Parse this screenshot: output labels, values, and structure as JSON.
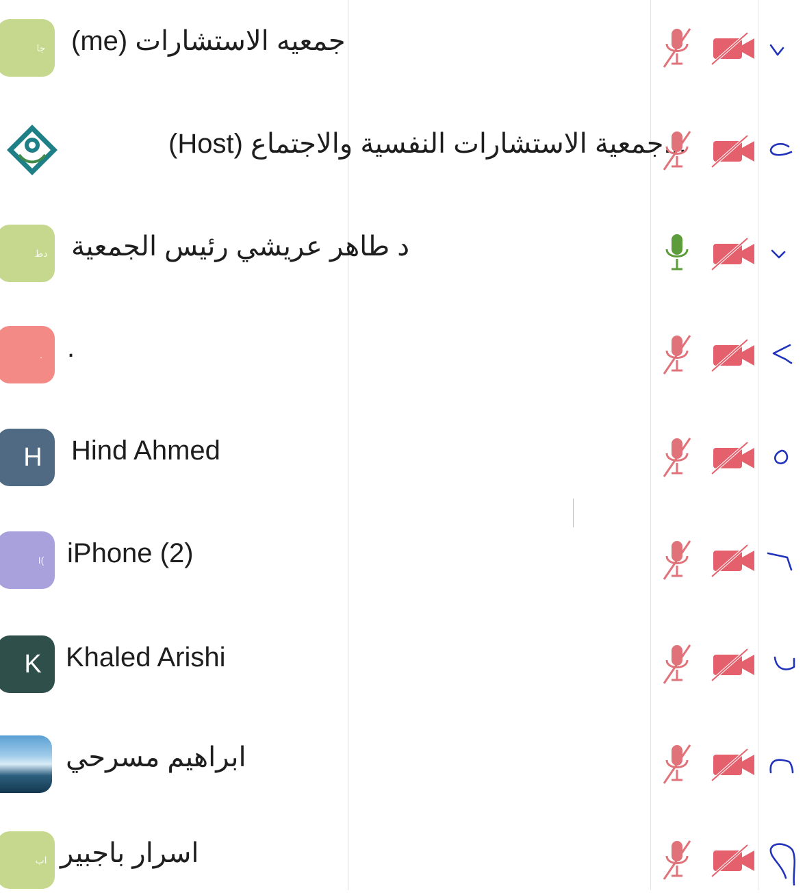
{
  "participants": [
    {
      "name": "(me) جمعيه الاستشارات",
      "avatar_label": "جا",
      "avatar_style": "pale",
      "avatar_color": "#c5d88e",
      "mic": "muted",
      "video": "off",
      "number_mark": "١"
    },
    {
      "name": "(Host)  جمعية الاستشارات النفسية والاجتماع...",
      "avatar_label": "",
      "avatar_style": "logo",
      "avatar_color": "#1f7f87",
      "mic": "muted",
      "video": "off",
      "number_mark": "٢"
    },
    {
      "name": "د طاهر عريشي رئيس الجمعية",
      "avatar_label": "دط",
      "avatar_style": "pale",
      "avatar_color": "#c5d88e",
      "mic": "active",
      "video": "off",
      "number_mark": "٣"
    },
    {
      "name": ".",
      "avatar_label": ".",
      "avatar_style": "pale",
      "avatar_color": "#f48a86",
      "mic": "muted",
      "video": "off",
      "number_mark": "٤"
    },
    {
      "name": "Hind Ahmed",
      "avatar_label": "H",
      "avatar_style": "big",
      "avatar_color": "#4f6a82",
      "mic": "muted",
      "video": "off",
      "number_mark": "٥"
    },
    {
      "name": "iPhone (2)",
      "avatar_label": "I(",
      "avatar_style": "pale",
      "avatar_color": "#a9a1dc",
      "mic": "muted",
      "video": "off",
      "number_mark": "٦"
    },
    {
      "name": "Khaled Arishi",
      "avatar_label": "K",
      "avatar_style": "big",
      "avatar_color": "#2f4f4a",
      "mic": "muted",
      "video": "off",
      "number_mark": "٧"
    },
    {
      "name": "ابراهيم مسرحي",
      "avatar_label": "",
      "avatar_style": "photo",
      "avatar_color": "#5b9fd4",
      "mic": "muted",
      "video": "off",
      "number_mark": "٨"
    },
    {
      "name": "اسرار باجبير",
      "avatar_label": "اب",
      "avatar_style": "pale",
      "avatar_color": "#c5d88e",
      "mic": "muted",
      "video": "off",
      "number_mark": "٩"
    }
  ],
  "colors": {
    "muted_icon": "#e0737a",
    "camera_off": "#e4606c",
    "mic_active": "#5c9c3a",
    "pen_ink": "#2233bb",
    "text": "#1e1e1e"
  }
}
